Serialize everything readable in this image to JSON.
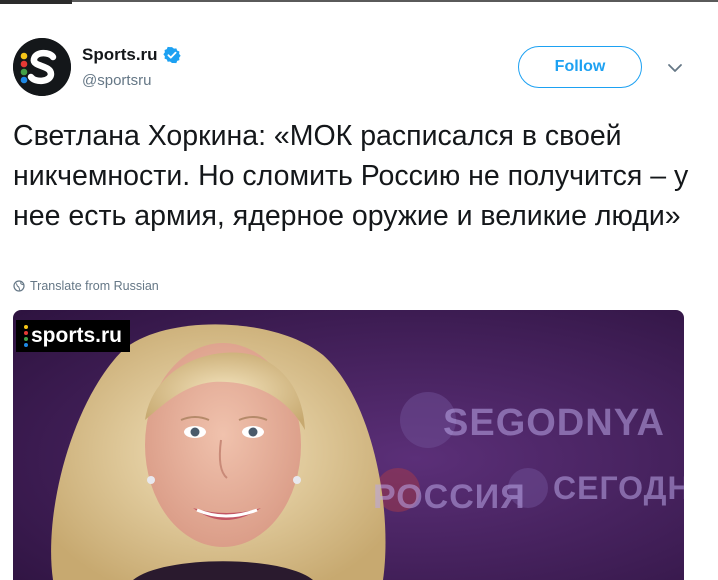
{
  "user": {
    "display_name": "Sports.ru",
    "handle": "@sportsru"
  },
  "follow_button": {
    "label": "Follow"
  },
  "tweet": {
    "text": "Светлана Хоркина: «МОК расписался в своей никчемности. Но сломить Россию не получится – у нее есть армия, ядерное оружие и великие люди»",
    "translate_label": "Translate from Russian"
  },
  "media": {
    "watermark": "sports.ru",
    "background_text_1": "SEGODNYA",
    "background_text_2": "РОССИЯ",
    "background_text_3": "СЕГОДНЯ"
  },
  "colors": {
    "accent": "#1da1f2",
    "text": "#14171a",
    "secondary_text": "#657786",
    "media_background": "#3b1a4f"
  }
}
